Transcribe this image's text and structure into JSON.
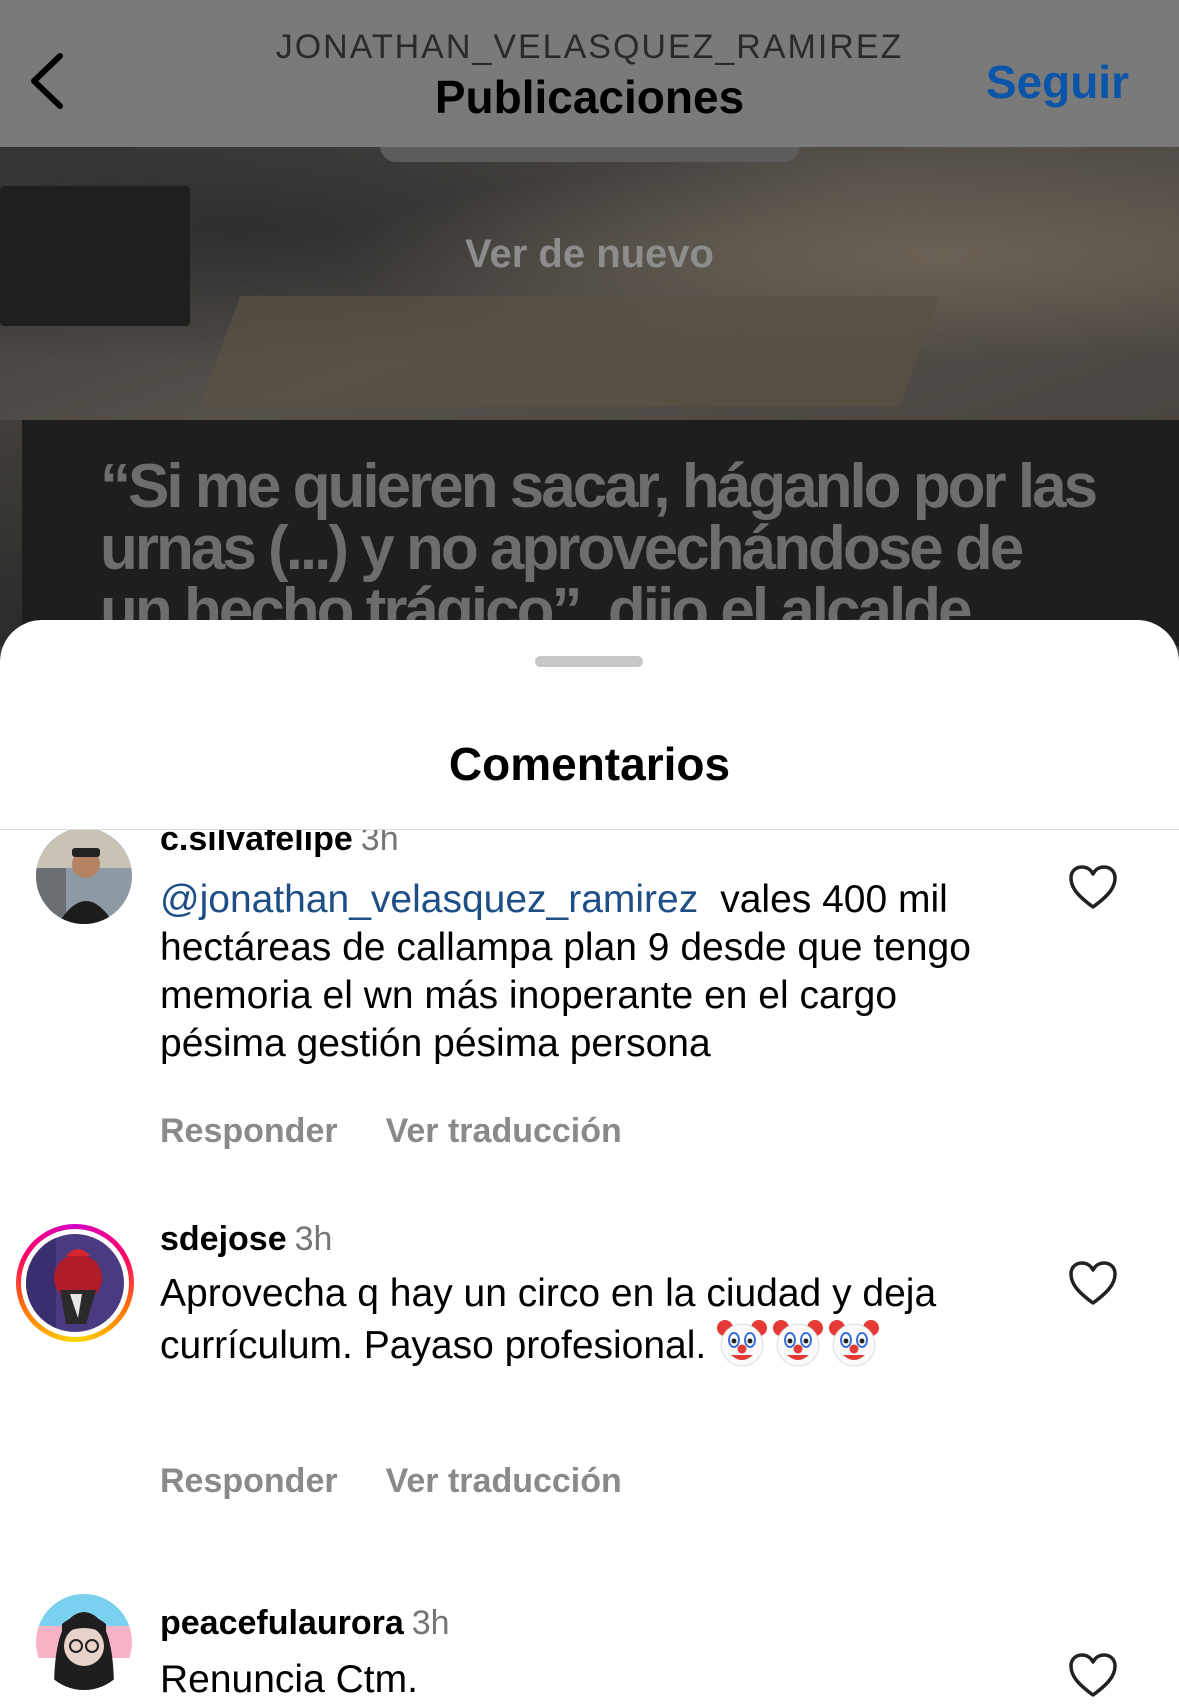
{
  "nav": {
    "profile_handle": "JONATHAN_VELASQUEZ_RAMIREZ",
    "title": "Publicaciones",
    "follow_label": "Seguir"
  },
  "post": {
    "replay_label": "Ver de nuevo",
    "headline": "“Si me quieren sacar, háganlo por las urnas (...) y no aprovechándose de un hecho trágico”, dijo el alcalde"
  },
  "sheet": {
    "title": "Comentarios"
  },
  "comments": [
    {
      "username": "c.silvafelipe",
      "time": "3h",
      "mention": "@jonathan_velasquez_ramirez",
      "text": "vales 400 mil hectáreas de callampa plan 9 desde que tengo memoria el wn más inoperante en el cargo pésima gestión pésima persona",
      "reply_label": "Responder",
      "translate_label": "Ver traducción"
    },
    {
      "username": "sdejose",
      "time": "3h",
      "text": "Aprovecha q hay un circo en la ciudad y deja currículum. Payaso profesional.",
      "emoji": "clown-face",
      "reply_label": "Responder",
      "translate_label": "Ver traducción"
    },
    {
      "username": "peacefulaurora",
      "time": "3h",
      "text": "Renuncia Ctm."
    }
  ],
  "colors": {
    "accent_link": "#0b55a8",
    "mention": "#1e4e86",
    "secondary_text": "#8a8a8a",
    "story_ring": "#ff0069"
  },
  "icons": [
    "chevron-left-icon",
    "heart-outline-icon",
    "clown-face-emoji"
  ]
}
